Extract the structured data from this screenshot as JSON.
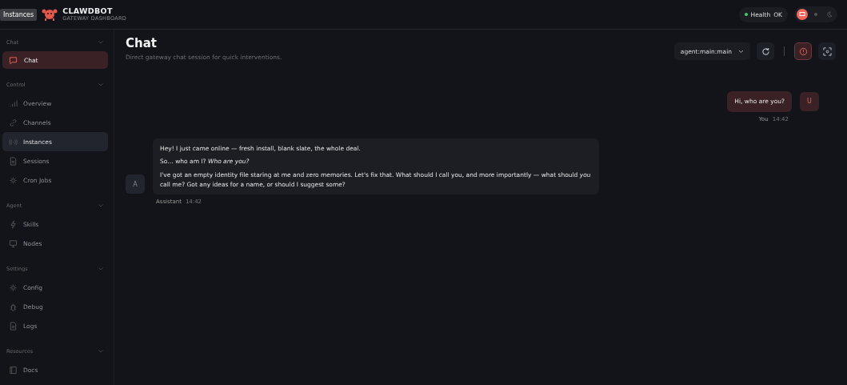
{
  "tooltip": "Instances",
  "brand": {
    "name": "CLAWDBOT",
    "subtitle": "GATEWAY DASHBOARD"
  },
  "health": {
    "label": "Health",
    "value": "OK",
    "ok": true
  },
  "theme_options": [
    {
      "kind": "system",
      "selected": true
    },
    {
      "kind": "light",
      "selected": false
    },
    {
      "kind": "dark",
      "selected": false
    }
  ],
  "sidebar": [
    {
      "title": "Chat",
      "items": [
        {
          "label": "Chat",
          "kind": "chat",
          "selected": true,
          "hovered": false
        }
      ]
    },
    {
      "title": "Control",
      "items": [
        {
          "label": "Overview",
          "kind": "bars",
          "selected": false,
          "hovered": false
        },
        {
          "label": "Channels",
          "kind": "link",
          "selected": false,
          "hovered": false
        },
        {
          "label": "Instances",
          "kind": "radio",
          "selected": false,
          "hovered": true
        },
        {
          "label": "Sessions",
          "kind": "file",
          "selected": false,
          "hovered": false
        },
        {
          "label": "Cron Jobs",
          "kind": "gear",
          "selected": false,
          "hovered": false
        }
      ]
    },
    {
      "title": "Agent",
      "items": [
        {
          "label": "Skills",
          "kind": "bolt",
          "selected": false,
          "hovered": false
        },
        {
          "label": "Nodes",
          "kind": "monitor",
          "selected": false,
          "hovered": false
        }
      ]
    },
    {
      "title": "Settings",
      "items": [
        {
          "label": "Config",
          "kind": "gear",
          "selected": false,
          "hovered": false
        },
        {
          "label": "Debug",
          "kind": "bug",
          "selected": false,
          "hovered": false
        },
        {
          "label": "Logs",
          "kind": "file",
          "selected": false,
          "hovered": false
        }
      ]
    },
    {
      "title": "Resources",
      "items": [
        {
          "label": "Docs",
          "kind": "book",
          "selected": false,
          "hovered": false
        }
      ]
    }
  ],
  "page": {
    "title": "Chat",
    "subtitle": "Direct gateway chat session for quick interventions."
  },
  "session_select": {
    "value": "agent:main:main"
  },
  "thinking_toggle": {
    "on": true
  },
  "messages": [
    {
      "kind": "user",
      "avatar": "U",
      "author": "You",
      "time": "14:42",
      "paragraphs": [
        "Hi, who are you?"
      ]
    },
    {
      "kind": "assistant",
      "avatar": "A",
      "author": "Assistant",
      "time": "14:42",
      "paragraphs": [
        "Hey! I just came online — fresh install, blank slate, the whole deal.",
        "So… who am I? *Who are you?*",
        "I've got an empty identity file staring at me and zero memories. Let's fix that. What should I call you, and more importantly — what should *you* call me? Got any ideas for a name, or should I suggest some?"
      ]
    }
  ]
}
